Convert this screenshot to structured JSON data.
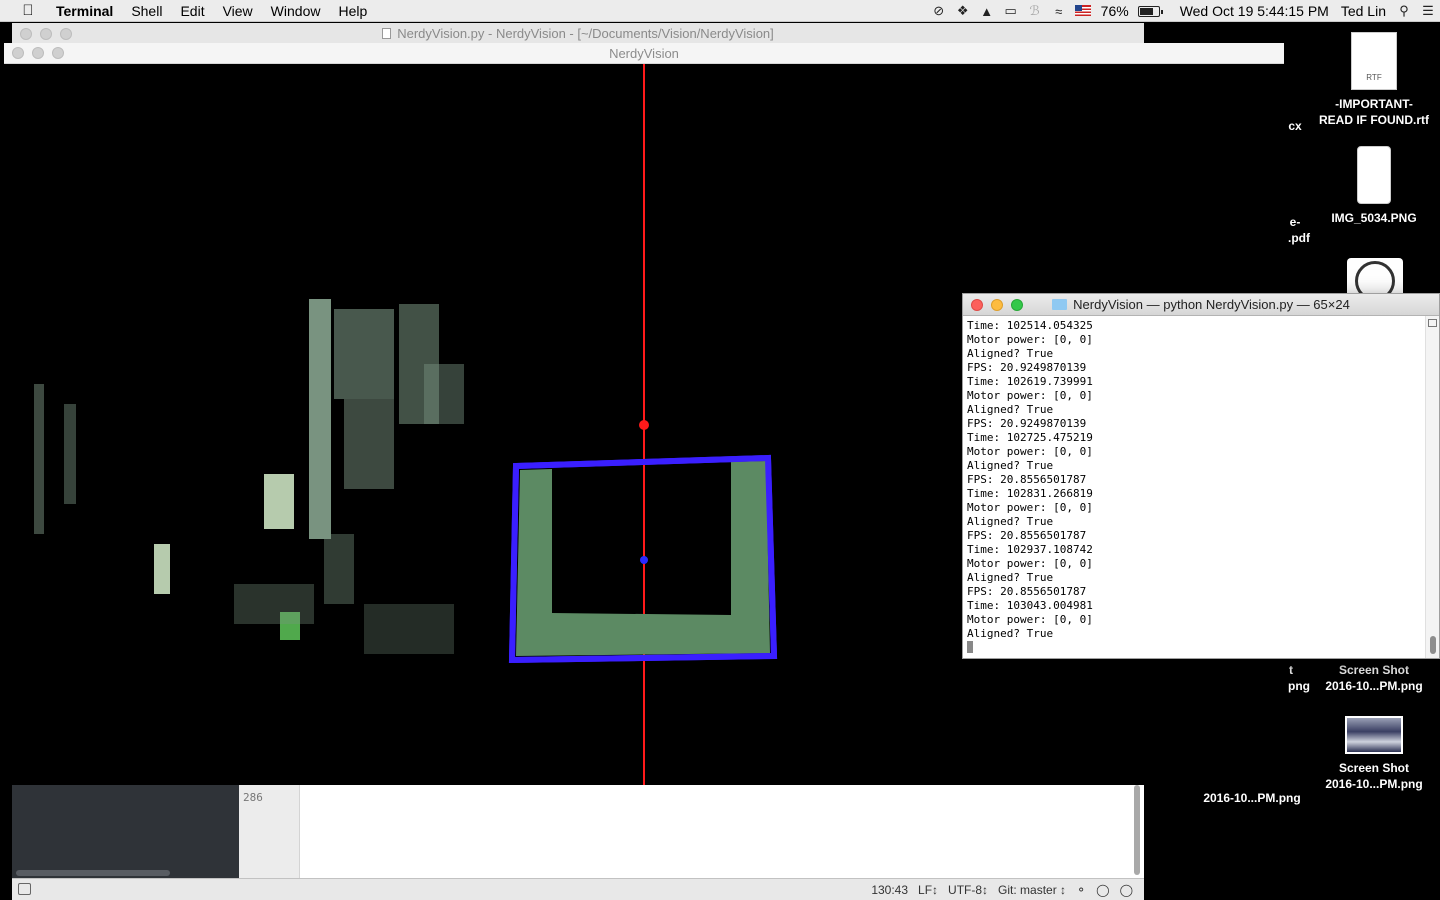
{
  "menubar": {
    "app_name": "Terminal",
    "items": [
      "Shell",
      "Edit",
      "View",
      "Window",
      "Help"
    ],
    "battery": "76%",
    "battery_level": 0.76,
    "clock": "Wed Oct 19  5:44:15 PM",
    "user": "Ted Lin"
  },
  "editor": {
    "title": "NerdyVision.py - NerdyVision - [~/Documents/Vision/NerdyVision]",
    "line_number": "286",
    "status": {
      "position": "130:43",
      "line_ending": "LF↕",
      "encoding": "UTF-8↕",
      "git": "Git: master ↕"
    }
  },
  "nerdyvision_window": {
    "title": "NerdyVision"
  },
  "terminal": {
    "title": "NerdyVision — python NerdyVision.py — 65×24",
    "lines": [
      "Time: 102514.054325",
      "Motor power: [0, 0]",
      "Aligned? True",
      "FPS: 20.9249870139",
      "Time: 102619.739991",
      "Motor power: [0, 0]",
      "Aligned? True",
      "FPS: 20.9249870139",
      "Time: 102725.475219",
      "Motor power: [0, 0]",
      "Aligned? True",
      "FPS: 20.8556501787",
      "Time: 102831.266819",
      "Motor power: [0, 0]",
      "Aligned? True",
      "FPS: 20.8556501787",
      "Time: 102937.108742",
      "Motor power: [0, 0]",
      "Aligned? True",
      "FPS: 20.8556501787",
      "Time: 103043.004981",
      "Motor power: [0, 0]",
      "Aligned? True"
    ]
  },
  "desktop": {
    "items": [
      {
        "name": "-IMPORTANT-\nREAD IF FOUND.rtf",
        "tag": "RTF"
      },
      {
        "name": "IMG_5034.PNG"
      },
      {
        "name": "Screen Shot\n2016-10...PM.png"
      },
      {
        "name": "Screen Shot\n2016-10...PM.png"
      },
      {
        "name": "2016-10...PM.png"
      }
    ],
    "partial_labels": [
      "cx",
      "e-",
      ".pdf",
      "t",
      "png"
    ]
  },
  "colors": {
    "target_outline": "#3a1fff",
    "target_fill": "#5c8a63",
    "center_line": "#ff1a1a",
    "center_dot": "#2a2aff"
  }
}
